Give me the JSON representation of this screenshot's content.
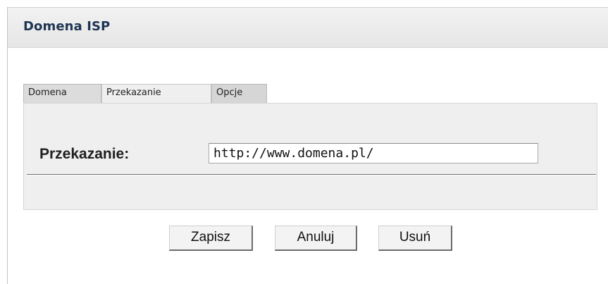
{
  "window": {
    "title": "Domena ISP"
  },
  "tabs": [
    {
      "label": "Domena"
    },
    {
      "label": "Przekazanie"
    },
    {
      "label": "Opcje"
    }
  ],
  "active_tab": "Przekazanie",
  "form": {
    "field_label": "Przekazanie:",
    "field_value": "http://www.domena.pl/"
  },
  "buttons": {
    "save_label": "Zapisz",
    "cancel_label": "Anuluj",
    "delete_label": "Usuń"
  }
}
